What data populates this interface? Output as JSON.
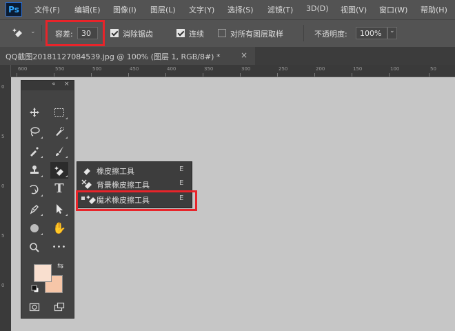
{
  "app": {
    "logo": "Ps"
  },
  "menubar": {
    "items": [
      "文件(F)",
      "编辑(E)",
      "图像(I)",
      "图层(L)",
      "文字(Y)",
      "选择(S)",
      "滤镜(T)",
      "3D(D)",
      "视图(V)",
      "窗口(W)",
      "帮助(H)"
    ]
  },
  "options": {
    "tolerance_label": "容差:",
    "tolerance_value": "30",
    "antialias_label": "消除锯齿",
    "antialias_checked": true,
    "contiguous_label": "连续",
    "contiguous_checked": true,
    "sample_all_label": "对所有图层取样",
    "sample_all_checked": false,
    "opacity_label": "不透明度:",
    "opacity_value": "100%"
  },
  "document": {
    "tab_title": "QQ截图20181127084539.jpg @ 100% (图层 1, RGB/8#) *",
    "close_glyph": "×"
  },
  "ruler": {
    "top_labels": [
      "600",
      "550",
      "500",
      "450",
      "400",
      "350",
      "300",
      "250",
      "200",
      "150",
      "100",
      "50"
    ],
    "left_labels": [
      "0",
      "5",
      "0",
      "5",
      "0"
    ]
  },
  "toolbox": {
    "collapse_glyph": "«",
    "close_glyph": "×",
    "swap_glyph": "⇆",
    "tools": [
      "move-tool",
      "marquee-tool",
      "lasso-tool",
      "quick-selection-tool",
      "eyedropper-tool",
      "brush-tool",
      "clone-stamp-tool",
      "eraser-tool",
      "history-brush-tool",
      "type-tool",
      "pen-tool",
      "path-selection-tool",
      "shape-tool",
      "hand-tool",
      "zoom-tool",
      "more-tools"
    ],
    "type_glyph": "T",
    "more_glyph": "•••",
    "hand_glyph": "✋",
    "foreground_color": "#f9dfcf",
    "background_color": "#f6c6a8"
  },
  "flyout": {
    "items": [
      {
        "label": "橡皮擦工具",
        "key": "E",
        "icon": "eraser-icon"
      },
      {
        "label": "背景橡皮擦工具",
        "key": "E",
        "icon": "background-eraser-icon"
      },
      {
        "label": "魔术橡皮擦工具",
        "key": "E",
        "icon": "magic-eraser-icon",
        "selected": true
      }
    ]
  },
  "colors": {
    "highlight": "#e8242a",
    "ui_dark": "#535353",
    "canvas": "#c6c6c6"
  }
}
